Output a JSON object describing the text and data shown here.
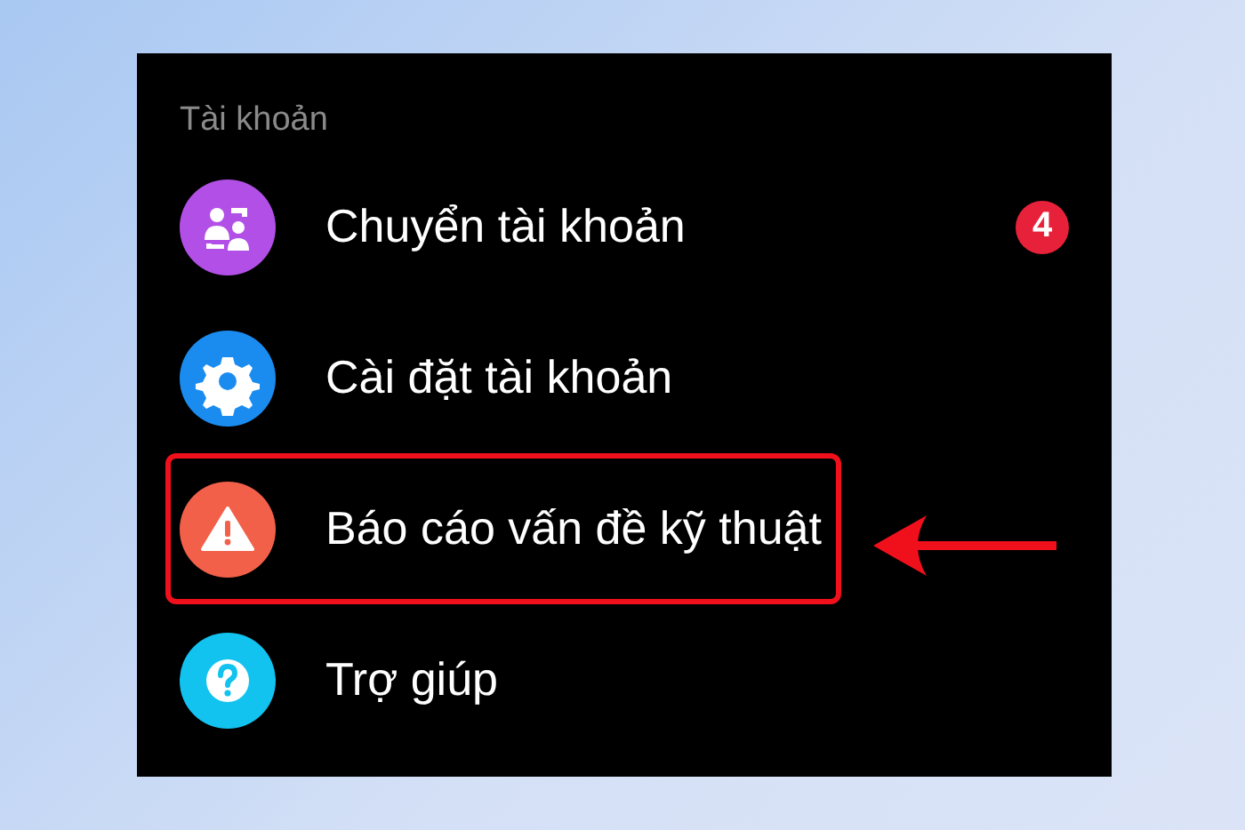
{
  "section_title": "Tài khoản",
  "items": [
    {
      "kind": "switch-account",
      "label": "Chuyển tài khoản",
      "color": "#b24fe6",
      "badge": "4",
      "highlighted": false
    },
    {
      "kind": "settings",
      "label": "Cài đặt tài khoản",
      "color": "#1a8cf0",
      "highlighted": false
    },
    {
      "kind": "warning",
      "label": "Báo cáo vấn đề kỹ thuật",
      "color": "#f2604a",
      "highlighted": true
    },
    {
      "kind": "help",
      "label": "Trợ giúp",
      "color": "#12c3f0",
      "highlighted": false
    }
  ]
}
